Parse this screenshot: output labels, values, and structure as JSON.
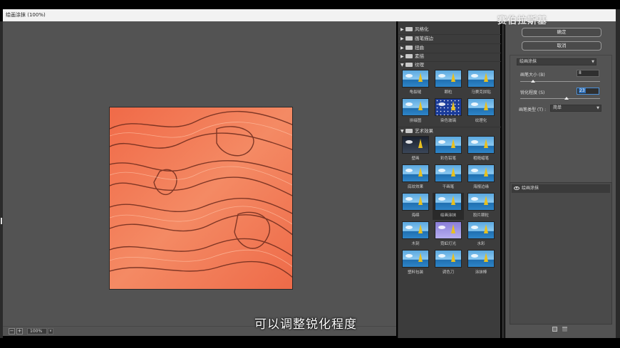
{
  "window": {
    "title": "绘画涂抹 (100%)"
  },
  "status": {
    "zoom": "100%",
    "minus": "−",
    "plus": "+",
    "dd": "v"
  },
  "gallery": {
    "categories_top": [
      "风格化",
      "画笔描边",
      "扭曲",
      "素描",
      "纹理"
    ],
    "texture_thumbs": [
      "龟裂缝",
      "颗粒",
      "马赛克拼贴",
      "拼缀图",
      "染色玻璃",
      "纹理化"
    ],
    "artistic_category": "艺术效果",
    "artistic_thumbs": [
      "壁画",
      "彩色铅笔",
      "粗糙蜡笔",
      "底纹效果",
      "干画笔",
      "海报边缘",
      "海绵",
      "绘画涂抹",
      "胶片颗粒",
      "木刻",
      "霓虹灯光",
      "水彩",
      "塑料包装",
      "调色刀",
      "涂抹棒"
    ],
    "selected": "绘画涂抹"
  },
  "buttons": {
    "ok": "确定",
    "cancel": "取消"
  },
  "filter": {
    "selected": "绘画涂抹",
    "brush_size_label": "画笔大小 (B)",
    "brush_size_value": "8",
    "sharpness_label": "锐化程度 (S)",
    "sharpness_value": "23",
    "brush_type_label": "画笔类型 (T) :",
    "brush_type_value": "简单"
  },
  "layers": {
    "items": [
      "绘画涂抹"
    ]
  },
  "overlay": {
    "watermark": "赛伯拉斯基",
    "subtitle": "可以调整锐化程度"
  },
  "colors": {
    "accent": "#4a90d9",
    "canvas_base": "#f0704a"
  },
  "sliders": {
    "brush_size_fraction": 0.16,
    "sharpness_fraction": 0.58
  }
}
